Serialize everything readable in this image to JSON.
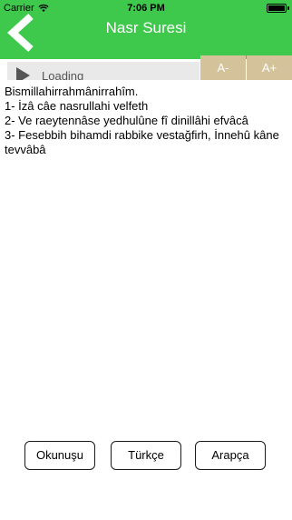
{
  "status_bar": {
    "carrier": "Carrier",
    "time": "7:06 PM"
  },
  "nav": {
    "title": "Nasr Suresi"
  },
  "player": {
    "loading_label": "Loading"
  },
  "font_controls": {
    "decrease_label": "A-",
    "increase_label": "A+"
  },
  "content": {
    "lines": [
      "Bismillahirrahmânirrahîm.",
      "1- İzâ câe nasrullahi velfeth",
      "2- Ve raeytennâse yedhulûne fî dinillâhi efvâcâ",
      "3- Fesebbih bihamdi rabbike vestağfirh, İnnehû kâne tevvâbâ"
    ]
  },
  "bottom_buttons": {
    "okunusu": "Okunuşu",
    "turkce": "Türkçe",
    "arapca": "Arapça"
  },
  "colors": {
    "header": "#3ec94c",
    "font_button": "#d4c39a"
  }
}
